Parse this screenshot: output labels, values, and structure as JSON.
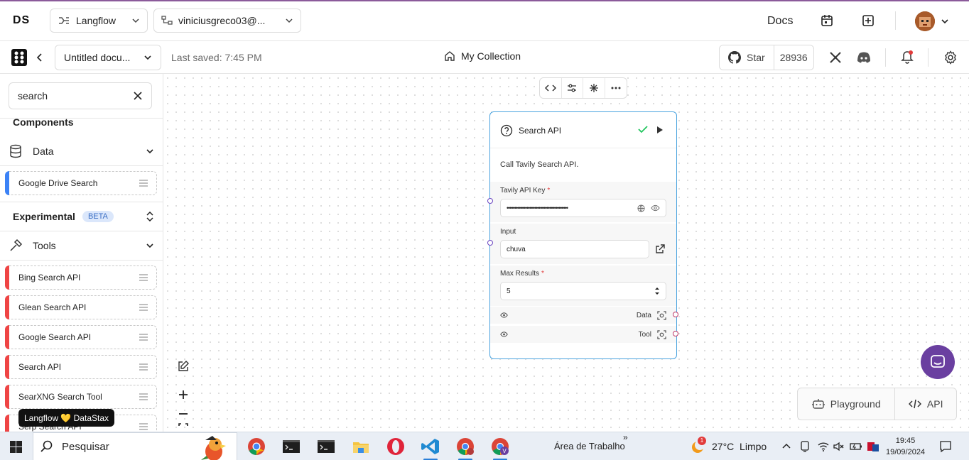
{
  "topbar": {
    "logo": "DS",
    "project_selector": "Langflow",
    "org_selector": "viniciusgreco03@...",
    "docs_label": "Docs"
  },
  "header": {
    "document_title": "Untitled docu...",
    "last_saved": "Last saved: 7:45 PM",
    "collection": "My Collection",
    "github_star_label": "Star",
    "github_star_count": "28936"
  },
  "sidebar": {
    "search_value": "search",
    "components_heading": "Components",
    "data_category": "Data",
    "data_items": [
      {
        "label": "Google Drive Search",
        "color": "#3b82f6"
      }
    ],
    "experimental_label": "Experimental",
    "beta_badge": "BETA",
    "tools_category": "Tools",
    "tool_items": [
      {
        "label": "Bing Search API",
        "color": "#ef4444"
      },
      {
        "label": "Glean Search API",
        "color": "#ef4444"
      },
      {
        "label": "Google Search API",
        "color": "#ef4444"
      },
      {
        "label": "Search API",
        "color": "#ef4444"
      },
      {
        "label": "SearXNG Search Tool",
        "color": "#ef4444"
      },
      {
        "label": "Serp Search API",
        "color": "#ef4444"
      }
    ],
    "brand_badge": "Langflow 💛 DataStax"
  },
  "node": {
    "title": "Search API",
    "description": "Call Tavily Search API.",
    "api_key_label": "Tavily API Key",
    "api_key_value": "••••••••••••••••••••••••••••••••••••••••",
    "input_label": "Input",
    "input_value": "chuva",
    "max_results_label": "Max Results",
    "max_results_value": "5",
    "output_data": "Data",
    "output_tool": "Tool",
    "required_mark": "*"
  },
  "bottom": {
    "playground_label": "Playground",
    "api_label": "API"
  },
  "taskbar": {
    "search_placeholder": "Pesquisar",
    "desktop_label": "Área de Trabalho",
    "chevrons": "»",
    "weather": "27°C  Limpo",
    "weather_alert": "1",
    "time": "19:45",
    "date": "19/09/2024"
  },
  "colors": {
    "node_border": "#4aa3df",
    "handle_input": "#6b46c1",
    "handle_output": "#be3a6a",
    "accent_purple": "#6a3fa0",
    "success_green": "#22c55e"
  }
}
